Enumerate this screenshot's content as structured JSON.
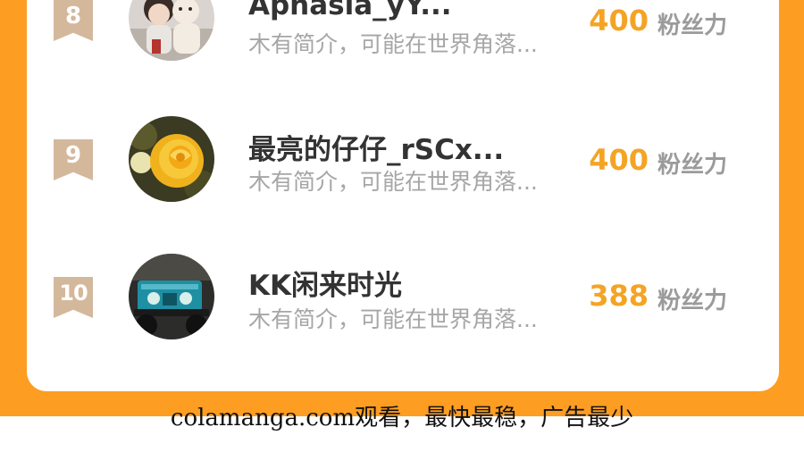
{
  "ranking": [
    {
      "rank": "8",
      "name": "Aphasia_yY...",
      "bio": "木有简介，可能在世界角落...",
      "fans_value": "400",
      "fans_label": "粉丝力",
      "avatar_icon": "avatar-couple-illustration-icon"
    },
    {
      "rank": "9",
      "name": "最亮的仔仔_rSCx...",
      "bio": "木有简介，可能在世界角落...",
      "fans_value": "400",
      "fans_label": "粉丝力",
      "avatar_icon": "avatar-yellow-rose-icon"
    },
    {
      "rank": "10",
      "name": "KK闲来时光",
      "bio": "木有简介，可能在世界角落...",
      "fans_value": "388",
      "fans_label": "粉丝力",
      "avatar_icon": "avatar-jeep-icon"
    }
  ],
  "footer": {
    "text": "colamanga.com观看，最快最稳，广告最少"
  },
  "colors": {
    "background_orange": "#fd9d22",
    "rank_badge": "#d4b89c",
    "fans_value": "#f4a425",
    "name_text": "#333333",
    "bio_text": "#a6a6a6"
  }
}
